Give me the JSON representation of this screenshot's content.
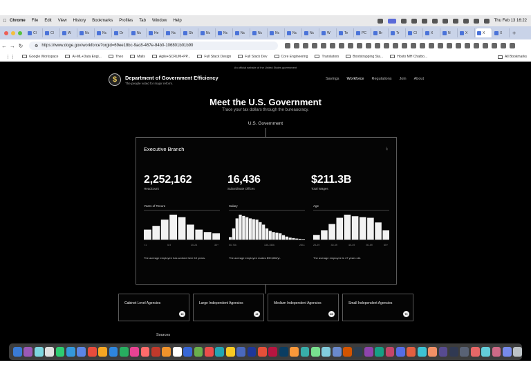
{
  "menubar": {
    "app": "Chrome",
    "items": [
      "File",
      "Edit",
      "View",
      "History",
      "Bookmarks",
      "Profiles",
      "Tab",
      "Window",
      "Help"
    ],
    "clock": "Thu Feb 13  16:22"
  },
  "browser": {
    "tab_labels": [
      "Cl",
      "Cl",
      "W",
      "Nc",
      "Nc",
      "Dr",
      "Nc",
      "He",
      "Nc",
      "Sh",
      "Nc",
      "Nc",
      "Nc",
      "Nc",
      "Nc",
      "Nc",
      "Nc",
      "W",
      "Te",
      "PC",
      "Br",
      "Tr",
      "Cl",
      "X",
      "N",
      "X",
      "X",
      "X"
    ],
    "url": "https://www.doge.gov/workforce?orgid=69ee18bc-9ac8-467e-84b0-106801b01b90",
    "bookmarks": [
      "Google Workspace",
      "AI-ML+Data Engi...",
      "Theo",
      "Mails",
      "Agile+SCRUM+PP...",
      "Full Stack Design",
      "Full Stack Dev",
      "Core Engineering",
      "Translators",
      "Bootstrapping Sta...",
      "Hosto MH Chatbo..."
    ],
    "all_bookmarks": "All Bookmarks"
  },
  "site": {
    "gov_banner": "An official website of the United States government",
    "name": "Department of Government Efficiency",
    "tagline": "The people voted for major reform.",
    "nav": [
      "Savings",
      "Workforce",
      "Regulations",
      "Join",
      "About"
    ],
    "title": "Meet the U.S. Government",
    "subtitle": "Trace your tax dollars through the bureaucracy.",
    "root_label": "U.S. Government"
  },
  "executive": {
    "title": "Executive Branch",
    "stats": [
      {
        "value": "2,252,162",
        "label": "Headcount"
      },
      {
        "value": "16,436",
        "label": "Subordinate Offices"
      },
      {
        "value": "$211.3B",
        "label": "Total Wages"
      }
    ],
    "charts": [
      {
        "title": "Years of Tenure",
        "ticks": [
          "<1",
          "5-9",
          "20-24",
          "30+"
        ],
        "caption": "The average employee has worked here 10 years."
      },
      {
        "title": "Salary",
        "ticks": [
          "50-70k",
          "130-150k",
          "250-300k"
        ],
        "caption": "The average employee makes $90,836/yr."
      },
      {
        "title": "Age",
        "ticks": [
          "25-29",
          "30-39",
          "40-49",
          "50-59",
          "65+"
        ],
        "caption": "The average employee is 47 years old."
      }
    ]
  },
  "chart_data": [
    {
      "type": "bar",
      "title": "Years of Tenure",
      "categories": [
        "<1",
        "1-2",
        "3-4",
        "5-9",
        "10-14",
        "15-19",
        "20-24",
        "25-29",
        "30+"
      ],
      "values": [
        40,
        55,
        80,
        100,
        90,
        60,
        40,
        30,
        25
      ]
    },
    {
      "type": "bar",
      "title": "Salary",
      "categories": [
        "<30k",
        "",
        "50-70k",
        "",
        "",
        "",
        "",
        "",
        "",
        "",
        "130-150k",
        "",
        "",
        "",
        "",
        "",
        "",
        "",
        "",
        "",
        "",
        "250-300k",
        ""
      ],
      "values": [
        10,
        45,
        85,
        100,
        95,
        90,
        85,
        82,
        80,
        70,
        60,
        45,
        35,
        30,
        28,
        25,
        18,
        12,
        8,
        6,
        4,
        3,
        2
      ]
    },
    {
      "type": "bar",
      "title": "Age",
      "categories": [
        "<25",
        "25-29",
        "30-34",
        "35-39",
        "40-44",
        "45-49",
        "50-54",
        "55-59",
        "60-64",
        "65+"
      ],
      "values": [
        15,
        30,
        50,
        70,
        80,
        75,
        72,
        70,
        55,
        30
      ]
    }
  ],
  "agencies": [
    {
      "name": "Cabinet Level Agencies",
      "count": "15"
    },
    {
      "name": "Large Independent Agencies",
      "count": "42"
    },
    {
      "name": "Medium Independent Agencies",
      "count": "65"
    },
    {
      "name": "Small Independent Agencies",
      "count": "79"
    }
  ],
  "sources": {
    "title": "Sources"
  }
}
